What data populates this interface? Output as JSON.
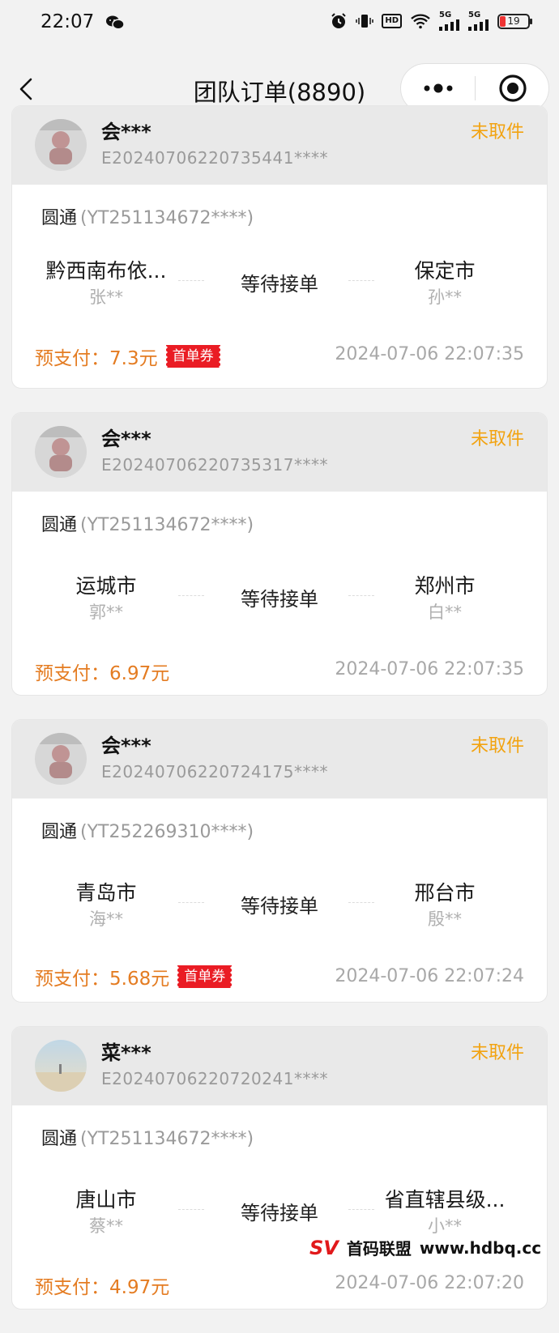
{
  "status_bar": {
    "time": "22:07",
    "battery": "19",
    "network_label_1": "5G",
    "network_label_2": "5G",
    "hd_label": "HD"
  },
  "nav": {
    "title": "团队订单(8890)"
  },
  "orders": [
    {
      "user": "会***",
      "order_no": "E20240706220735441****",
      "status": "未取件",
      "carrier": "圆通",
      "tracking": "(YT251134672****)",
      "from_city": "黔西南布依...",
      "from_person": "张**",
      "state": "等待接单",
      "to_city": "保定市",
      "to_person": "孙**",
      "pay": "预支付：7.3元",
      "coupon": "首单券",
      "time": "2024-07-06 22:07:35"
    },
    {
      "user": "会***",
      "order_no": "E20240706220735317****",
      "status": "未取件",
      "carrier": "圆通",
      "tracking": "(YT251134672****)",
      "from_city": "运城市",
      "from_person": "郭**",
      "state": "等待接单",
      "to_city": "郑州市",
      "to_person": "白**",
      "pay": "预支付：6.97元",
      "coupon": "",
      "time": "2024-07-06 22:07:35"
    },
    {
      "user": "会***",
      "order_no": "E20240706220724175****",
      "status": "未取件",
      "carrier": "圆通",
      "tracking": "(YT252269310****)",
      "from_city": "青岛市",
      "from_person": "海**",
      "state": "等待接单",
      "to_city": "邢台市",
      "to_person": "殷**",
      "pay": "预支付：5.68元",
      "coupon": "首单券",
      "time": "2024-07-06 22:07:24"
    },
    {
      "user": "菜***",
      "order_no": "E20240706220720241****",
      "status": "未取件",
      "carrier": "圆通",
      "tracking": "(YT251134672****)",
      "from_city": "唐山市",
      "from_person": "蔡**",
      "state": "等待接单",
      "to_city": "省直辖县级...",
      "to_person": "小**",
      "pay": "预支付：4.97元",
      "coupon": "",
      "time": "2024-07-06 22:07:20"
    }
  ],
  "watermark": {
    "logo": "SV",
    "name": "首码联盟",
    "url": "www.hdbq.cc"
  },
  "colors": {
    "status": "#f2a311",
    "pay": "#e47c22",
    "coupon": "#ea1c24"
  }
}
